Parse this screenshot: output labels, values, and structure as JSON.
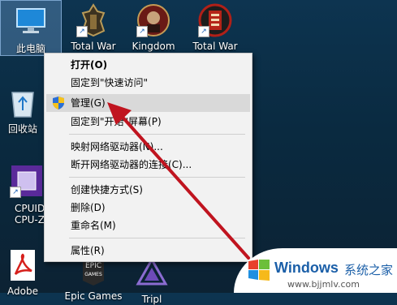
{
  "desktop": {
    "icons": [
      {
        "label": "此电脑"
      },
      {
        "label": "Total War"
      },
      {
        "label": "Kingdom"
      },
      {
        "label": "Total War"
      },
      {
        "label": "回收站"
      },
      {
        "label": "CPUID"
      },
      {
        "label": "CPU-Z"
      },
      {
        "label": "Adobe"
      },
      {
        "label": "Epic Games"
      },
      {
        "label": "Tripl"
      }
    ]
  },
  "context_menu": {
    "items": [
      {
        "label": "打开(O)"
      },
      {
        "label": "固定到\"快速访问\""
      },
      {
        "label": "管理(G)"
      },
      {
        "label": "固定到\"开始\"屏幕(P)"
      },
      {
        "label": "映射网络驱动器(N)..."
      },
      {
        "label": "断开网络驱动器的连接(C)..."
      },
      {
        "label": "创建快捷方式(S)"
      },
      {
        "label": "删除(D)"
      },
      {
        "label": "重命名(M)"
      },
      {
        "label": "属性(R)"
      }
    ],
    "highlighted_index": 2
  },
  "watermark": {
    "brand": "Windows",
    "site_cn": "系统之家",
    "url": "www.bjjmlv.com",
    "colors": {
      "red": "#e8412c",
      "green": "#6cbf3a",
      "blue": "#1f8fe0",
      "yellow": "#f6b91a",
      "text": "#1b5fa8"
    }
  },
  "annotation": {
    "arrow_color": "#c0141f"
  }
}
